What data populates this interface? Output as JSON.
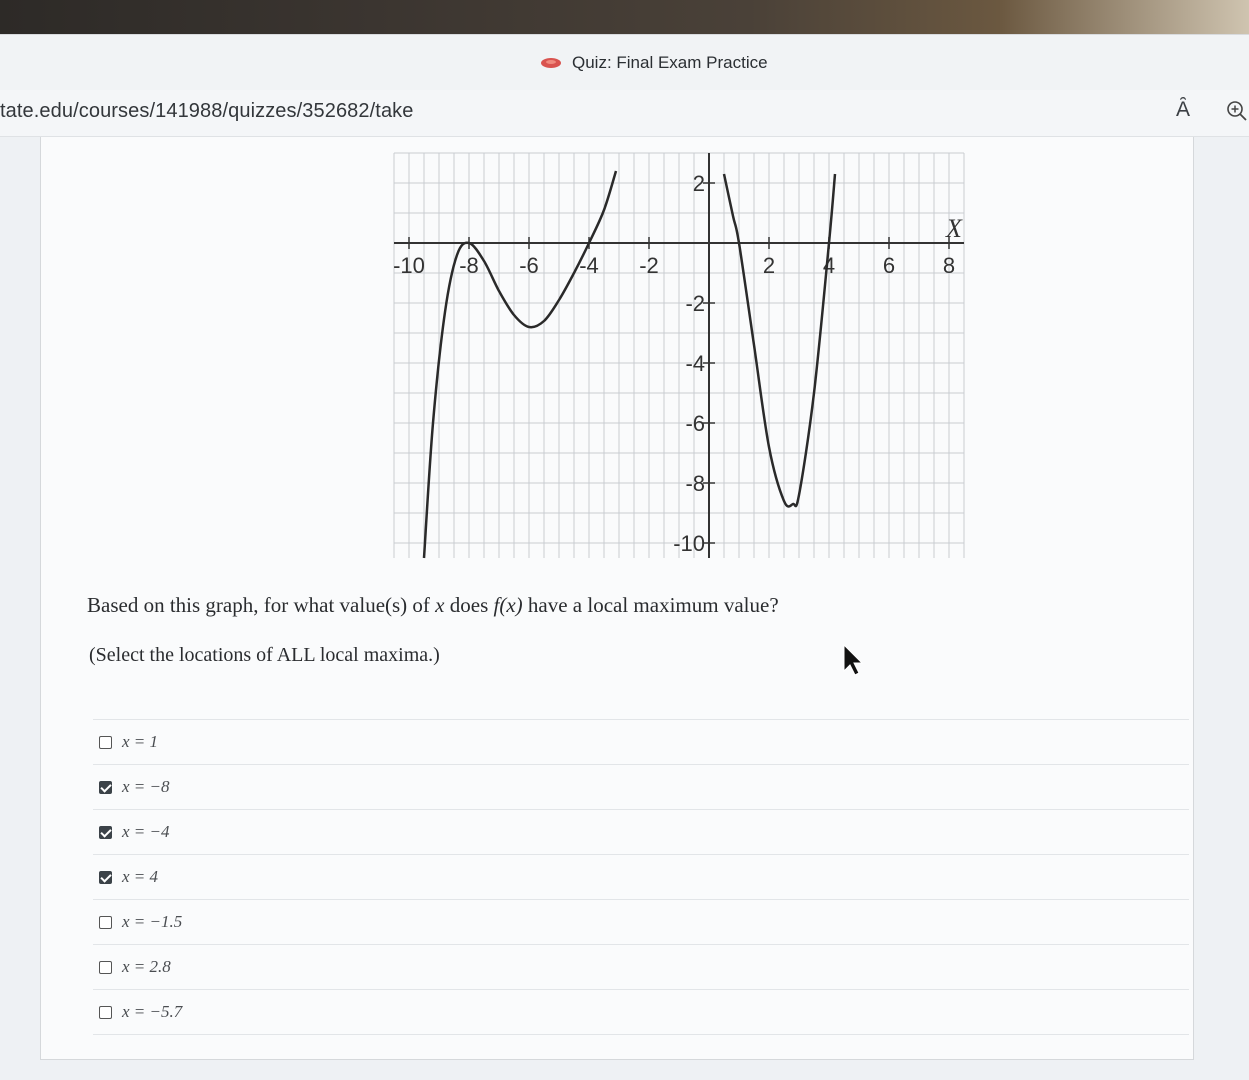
{
  "browser": {
    "tab_title": "Quiz: Final Exam Practice",
    "url": "tate.edu/courses/141988/quizzes/352682/take",
    "read_aloud_label": "Ȃ",
    "colors": {
      "favicon": "#d9534f"
    }
  },
  "question": {
    "text": "Based on this graph, for what value(s) of x does f(x) have a local maximum value?",
    "hint": "(Select the locations of ALL local maxima.)"
  },
  "answers": [
    {
      "label": "x = 1",
      "checked": false
    },
    {
      "label": "x = −8",
      "checked": true
    },
    {
      "label": "x = −4",
      "checked": true
    },
    {
      "label": "x = 4",
      "checked": true
    },
    {
      "label": "x = −1.5",
      "checked": false
    },
    {
      "label": "x = 2.8",
      "checked": false
    },
    {
      "label": "x = −5.7",
      "checked": false
    }
  ],
  "chart_data": {
    "type": "line",
    "xlabel": "X",
    "x_ticks": [
      "-10",
      "-8",
      "-6",
      "-4",
      "-2",
      "2",
      "4",
      "6",
      "8"
    ],
    "y_ticks": [
      "2",
      "-2",
      "-4",
      "-6",
      "-8",
      "-10"
    ],
    "xlim": [
      -10.5,
      8.5
    ],
    "ylim": [
      -10.5,
      3
    ],
    "grid": true,
    "series": [
      {
        "x": [
          -9.5,
          -9.2,
          -8.8,
          -8.4,
          -8,
          -7.5,
          -7,
          -6.5,
          -6,
          -5.5,
          -5,
          -4.5,
          -4,
          -3.5,
          -3.1
        ],
        "y": [
          -10.5,
          -6.0,
          -2.3,
          -0.4,
          0,
          -0.6,
          -1.6,
          -2.4,
          -2.8,
          -2.6,
          -1.9,
          -1.0,
          0,
          1.1,
          2.4
        ]
      },
      {
        "x": [
          0.5,
          0.8,
          1,
          1.5,
          2,
          2.5,
          2.8,
          3,
          3.5,
          4,
          4.2
        ],
        "y": [
          2.3,
          0.9,
          0,
          -3.4,
          -6.8,
          -8.6,
          -8.7,
          -8.4,
          -5.0,
          0,
          2.3
        ]
      }
    ]
  }
}
